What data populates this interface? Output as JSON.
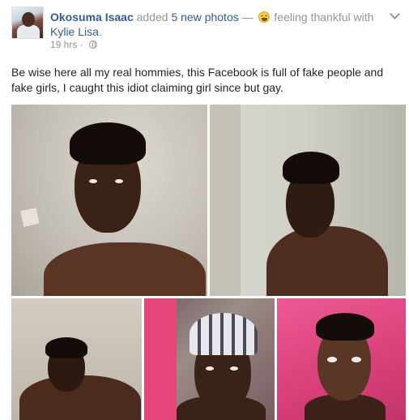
{
  "post": {
    "author": "Okosuma Isaac",
    "action_prefix": "added",
    "photos_link": "5 new photos",
    "separator": "—",
    "feeling_text": "feeling thankful with",
    "tagged_user": "Kylie Lisa",
    "period": ".",
    "timestamp": "19 hrs",
    "timestamp_separator": "·",
    "privacy_icon": "globe-icon",
    "menu_icon": "chevron-down-icon",
    "emoji_icon": "happy-emoji-icon",
    "body": "Be wise here all my real hommies, this Facebook is full of fake people and fake girls, I caught this idiot claiming girl since but gay."
  },
  "photos": [
    {
      "icon": "photo-1"
    },
    {
      "icon": "photo-2"
    },
    {
      "icon": "photo-3"
    },
    {
      "icon": "photo-4"
    },
    {
      "icon": "photo-5"
    }
  ],
  "colors": {
    "link": "#365899",
    "muted": "#90949c",
    "text": "#1d2129",
    "background": "#ffffff"
  }
}
